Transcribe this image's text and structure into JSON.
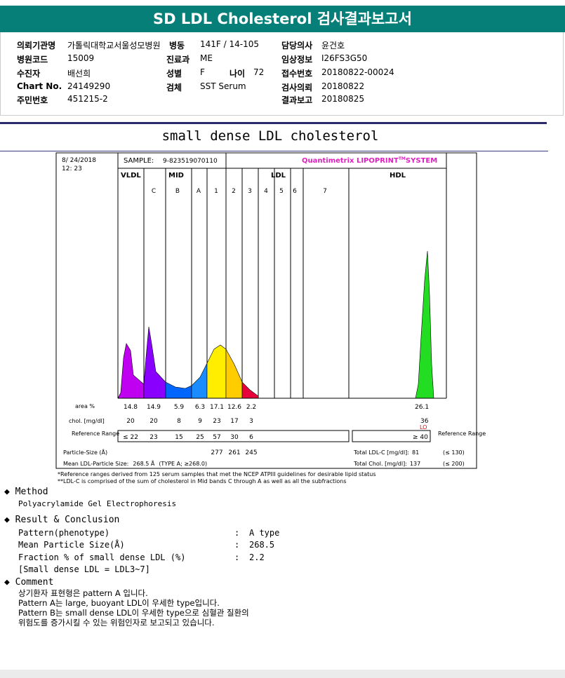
{
  "report_title": "SD LDL Cholesterol 검사결과보고서",
  "header": {
    "rows": [
      {
        "l1": "의뢰기관명",
        "v1": "가톨릭대학교서울성모병원",
        "l2": "병동",
        "v2": "141F / 14-105",
        "l3": "담당의사",
        "v3": "윤건호"
      },
      {
        "l1": "병원코드",
        "v1": "15009",
        "l2": "진료과",
        "v2": "ME",
        "l3": "임상정보",
        "v3": "I26FS3G50"
      },
      {
        "l1": "수진자",
        "v1": "배선희",
        "l2": "성별",
        "v2": "F",
        "l2b": "나이",
        "v2b": "72",
        "l3": "접수번호",
        "v3": "20180822-00024"
      },
      {
        "l1": "Chart No.",
        "v1": "24149290",
        "l2": "검체",
        "v2": "SST Serum",
        "l3": "검사의뢰",
        "v3": "20180822"
      },
      {
        "l1": "주민번호",
        "v1": "451215-2",
        "l2": "",
        "v2": "",
        "l3": "결과보고",
        "v3": "20180825"
      }
    ]
  },
  "section_title": "small dense LDL cholesterol",
  "chart": {
    "date": "8/ 24/2018",
    "time": "12: 23",
    "sample_label": "SAMPLE:",
    "sample_id": "9-823519070110",
    "brand": "Quantimetrix LIPOPRINT",
    "brand_tm": "TM",
    "brand_tail": "SYSTEM",
    "band_groups": [
      "VLDL",
      "MID",
      "LDL",
      "HDL"
    ],
    "sub_bands": [
      "C",
      "B",
      "A",
      "1",
      "2",
      "3",
      "4",
      "5",
      "6",
      "7"
    ],
    "row_area_label": "area %",
    "row_chol_label": "chol. [mg/dl]",
    "row_ref_label": "Reference Range",
    "area_values": [
      "14.8",
      "14.9",
      "5.9",
      "6.3",
      "17.1",
      "12.6",
      "2.2"
    ],
    "chol_values": [
      "20",
      "20",
      "8",
      "9",
      "23",
      "17",
      "3"
    ],
    "ref_values": [
      "≤ 22",
      "23",
      "15",
      "25",
      "57",
      "30",
      "6"
    ],
    "hdl_area": "26.1",
    "hdl_chol": "36",
    "hdl_flag": "LO",
    "hdl_ref": "≥ 40",
    "ref_range_side": "Reference Range",
    "particle_size_label": "Particle-Size (Å)",
    "particle_sizes": [
      "277",
      "261",
      "245"
    ],
    "mean_size_label": "Mean LDL-Particle Size:",
    "mean_size_value": "268.5 Å",
    "mean_size_type": "(TYPE A; ≥268.0)",
    "total_ldl_label": "Total LDL-C [mg/dl]:",
    "total_ldl_value": "81",
    "total_ldl_ref": "(≤ 130)",
    "total_chol_label": "Total Chol. [mg/dl]:",
    "total_chol_value": "137",
    "total_chol_ref": "(≤ 200)",
    "footnote1": "*Reference ranges derived from 125 serum samples that met the NCEP ATPIII guidelines for desirable lipid status",
    "footnote2": "**LDL-C is comprised of the sum of cholesterol in Mid bands C through A as well as all the subfractions"
  },
  "method": {
    "heading": "Method",
    "text": "Polyacrylamide Gel Electrophoresis"
  },
  "result": {
    "heading": "Result & Conclusion",
    "rows": [
      {
        "label": "Pattern(phenotype)",
        "sep": ":",
        "value": "A type"
      },
      {
        "label": "Mean Particle Size(Å)",
        "sep": ":",
        "value": "268.5"
      },
      {
        "label": "Fraction % of small dense LDL (%)",
        "sep": ":",
        "value": "2.2"
      }
    ],
    "note": "[Small dense LDL = LDL3~7]"
  },
  "comment": {
    "heading": "Comment",
    "lines": [
      "상기환자 표현형은 pattern A 입니다.",
      "Pattern A는 large, buoyant LDL이 우세한 type입니다.",
      "Pattern B는 small dense LDL이 우세한 type으로 심혈관 질환의",
      "위험도를 증가시킬 수 있는 위험인자로 보고되고 있습니다."
    ]
  },
  "colors": {
    "banner": "#067f79",
    "vldl": "#c000f0",
    "mid_c": "#8a00ff",
    "mid_b": "#0066ff",
    "mid_a": "#1a8cff",
    "ldl1": "#ffee00",
    "ldl2": "#ffcc00",
    "ldl3": "#e8003a",
    "hdl": "#22dd22",
    "brand": "#e020c0"
  }
}
